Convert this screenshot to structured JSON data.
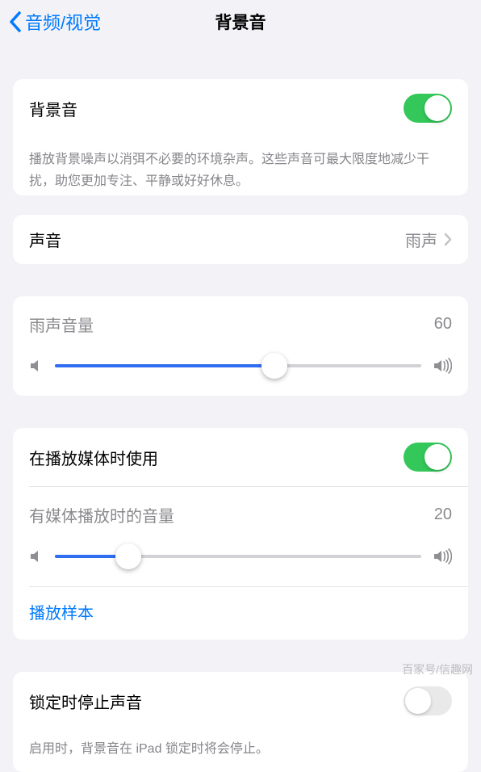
{
  "header": {
    "back_label": "音频/视觉",
    "title": "背景音"
  },
  "s1": {
    "label": "背景音",
    "toggle": true,
    "note": "播放背景噪声以消弭不必要的环境杂声。这些声音可最大限度地减少干扰，助您更加专注、平静或好好休息。"
  },
  "s2": {
    "label": "声音",
    "value": "雨声"
  },
  "s3": {
    "label": "雨声音量",
    "value": "60",
    "percent": 60
  },
  "s4": {
    "use_label": "在播放媒体时使用",
    "use_toggle": true,
    "vol_label": "有媒体播放时的音量",
    "vol_value": "20",
    "vol_percent": 20,
    "sample": "播放样本"
  },
  "s5": {
    "label": "锁定时停止声音",
    "toggle": false,
    "note": "启用时，背景音在 iPad 锁定时将会停止。"
  },
  "watermark": "百家号/信趣网"
}
